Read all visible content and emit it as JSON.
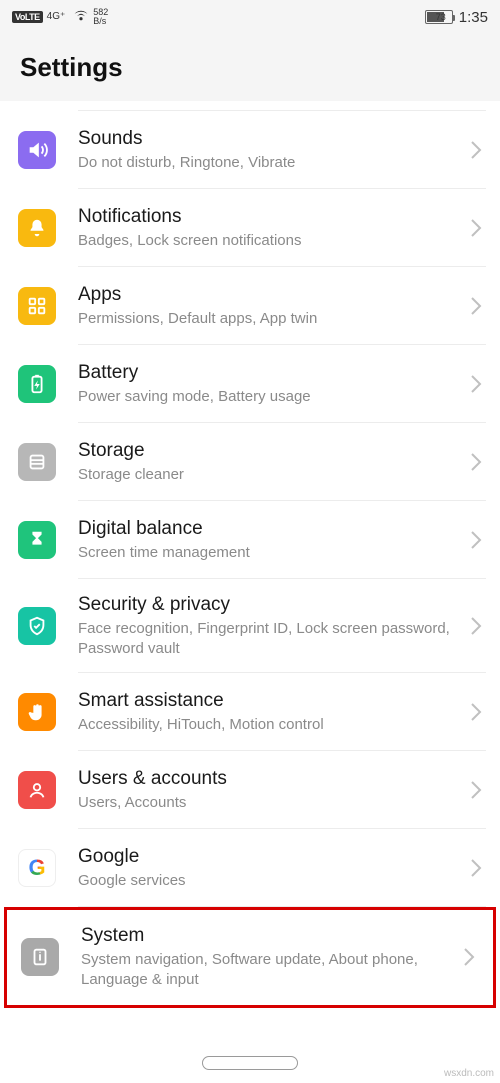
{
  "statusbar": {
    "volte": "VoLTE",
    "signal": "4G⁺",
    "net_rate": "582",
    "net_unit": "B/s",
    "battery_pct": "73",
    "time": "1:35"
  },
  "header": {
    "title": "Settings"
  },
  "items": [
    {
      "key": "sounds",
      "title": "Sounds",
      "sub": "Do not disturb, Ringtone, Vibrate",
      "icon": "sound-icon",
      "bg": "bg-purple"
    },
    {
      "key": "notifications",
      "title": "Notifications",
      "sub": "Badges, Lock screen notifications",
      "icon": "bell-icon",
      "bg": "bg-yellow"
    },
    {
      "key": "apps",
      "title": "Apps",
      "sub": "Permissions, Default apps, App twin",
      "icon": "apps-icon",
      "bg": "bg-yellow2"
    },
    {
      "key": "battery",
      "title": "Battery",
      "sub": "Power saving mode, Battery usage",
      "icon": "battery-icon",
      "bg": "bg-green"
    },
    {
      "key": "storage",
      "title": "Storage",
      "sub": "Storage cleaner",
      "icon": "storage-icon",
      "bg": "bg-grey"
    },
    {
      "key": "digital",
      "title": "Digital balance",
      "sub": "Screen time management",
      "icon": "hourglass-icon",
      "bg": "bg-green2"
    },
    {
      "key": "security",
      "title": "Security & privacy",
      "sub": "Face recognition, Fingerprint ID, Lock screen password, Password vault",
      "icon": "shield-icon",
      "bg": "bg-teal"
    },
    {
      "key": "smart",
      "title": "Smart assistance",
      "sub": "Accessibility, HiTouch, Motion control",
      "icon": "hand-icon",
      "bg": "bg-orange"
    },
    {
      "key": "users",
      "title": "Users & accounts",
      "sub": "Users, Accounts",
      "icon": "user-icon",
      "bg": "bg-red"
    },
    {
      "key": "google",
      "title": "Google",
      "sub": "Google services",
      "icon": "google-icon",
      "bg": "bg-white"
    },
    {
      "key": "system",
      "title": "System",
      "sub": "System navigation, Software update, About phone, Language & input",
      "icon": "info-icon",
      "bg": "bg-grey2",
      "highlighted": true
    }
  ],
  "watermark": "wsxdn.com"
}
